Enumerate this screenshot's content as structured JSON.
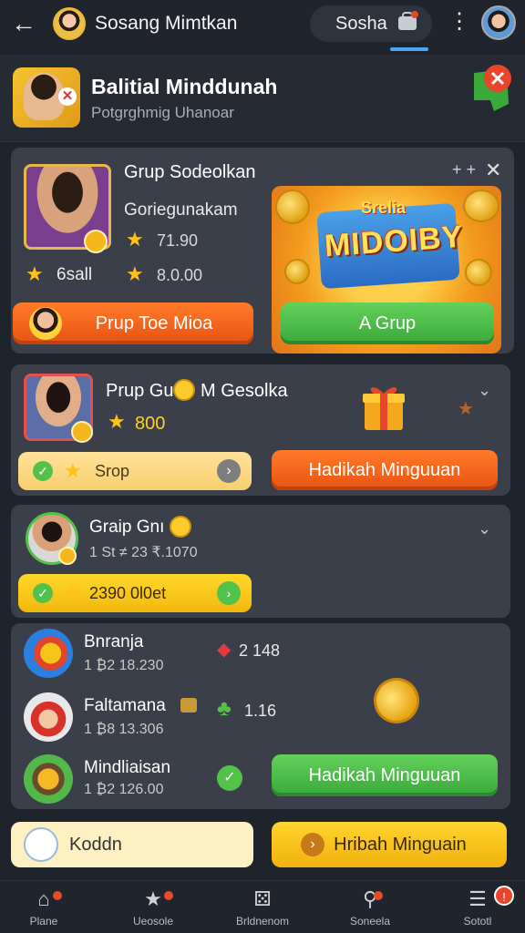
{
  "topbar": {
    "title": "Sosang Mimtkan",
    "pill_label": "Sosha"
  },
  "header": {
    "title": "Balitial Minddunah",
    "subtitle": "Potgrghmig Uhanoar"
  },
  "card1": {
    "name": "Grup Sodeolkan",
    "sub": "Goriegunakam",
    "val1": "71.90",
    "val2": "6sall",
    "val3": "8.0.00",
    "plus_label": "+ +",
    "left_button": "Prup Toe Mioa",
    "right_button": "A Grup",
    "promo_top": "Srelia",
    "promo_title": "MIDOIBY"
  },
  "card2": {
    "name": "Prup Gu",
    "name2": "M Gesolka",
    "value": "800",
    "chip_label": "Srop",
    "button": "Hadikah Minguuan"
  },
  "card3": {
    "name": "Graip Gnı",
    "sub": "1 St ≠ 23 ₹.1070",
    "chip_label": "2390 0l0et"
  },
  "list": [
    {
      "name": "Bnranja",
      "sub": "1 ₿2 18.230",
      "tag": "2 148"
    },
    {
      "name": "Faltamana",
      "sub": "1 ₿8 13.306",
      "tag": "1.16"
    },
    {
      "name": "Mindliaisan",
      "sub": "1 ₿2 126.00"
    }
  ],
  "list_button": "Hadikah Minguuan",
  "bottom": {
    "left_label": "Koddn",
    "right_label": "Hribah Minguain"
  },
  "nav": [
    {
      "label": "Plane",
      "icon": "home-icon"
    },
    {
      "label": "Ueosole",
      "icon": "star-icon"
    },
    {
      "label": "Brldnenom",
      "icon": "dice-icon"
    },
    {
      "label": "Soneela",
      "icon": "search-icon"
    },
    {
      "label": "Sototl",
      "icon": "menu-icon"
    }
  ],
  "colors": {
    "background": "#1f232b",
    "card": "#3a3f49",
    "accent_orange": "#e85312",
    "accent_green": "#3aa93a",
    "accent_yellow": "#f2b30e"
  }
}
